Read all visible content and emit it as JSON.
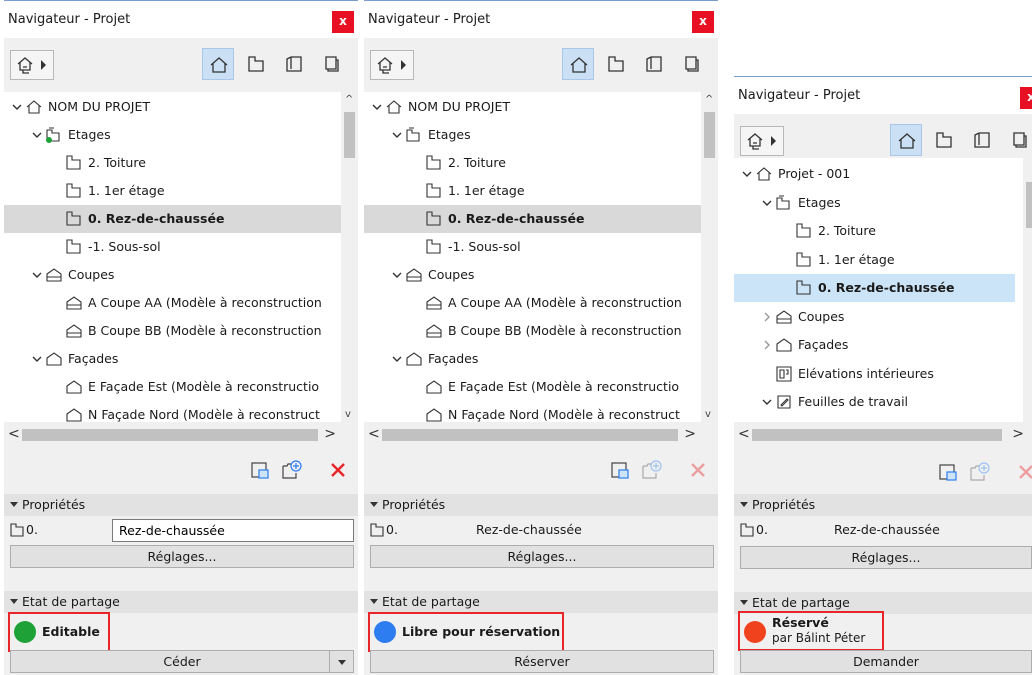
{
  "colors": {
    "accent": "#cce0f5",
    "close": "#e81123",
    "highlight": "#e8262a",
    "green": "#1ea238",
    "blue": "#2d7df0",
    "red": "#f0421c",
    "delete": "#e8262a"
  },
  "panels": [
    {
      "title": "Navigateur - Projet",
      "close": "x",
      "tree": [
        {
          "label": "NOM DU PROJET",
          "icon": "project-icon",
          "expander": "expanded"
        },
        {
          "label": "Etages",
          "icon": "stories-icon",
          "expander": "expanded"
        },
        {
          "label": "2. Toiture",
          "icon": "story-icon"
        },
        {
          "label": "1. 1er étage",
          "icon": "story-icon"
        },
        {
          "label": "0. Rez-de-chaussée",
          "icon": "story-icon"
        },
        {
          "label": "-1. Sous-sol",
          "icon": "story-icon"
        },
        {
          "label": "Coupes",
          "icon": "section-icon",
          "expander": "expanded"
        },
        {
          "label": "A Coupe AA (Modèle à reconstruction",
          "icon": "section-icon"
        },
        {
          "label": "B Coupe BB (Modèle à reconstruction",
          "icon": "section-icon"
        },
        {
          "label": "Façades",
          "icon": "elevation-icon",
          "expander": "expanded"
        },
        {
          "label": "E Façade Est (Modèle à reconstructio",
          "icon": "elevation-icon"
        },
        {
          "label": "N Façade Nord (Modèle à reconstruct",
          "icon": "elevation-icon"
        }
      ],
      "properties": {
        "header": "Propriétés",
        "number": "0.",
        "name": "Rez-de-chaussée",
        "settings": "Réglages..."
      },
      "sharing": {
        "header": "Etat de partage",
        "status": "Editable",
        "status_color": "green",
        "action": "Céder"
      }
    },
    {
      "title": "Navigateur - Projet",
      "close": "x",
      "tree": [
        {
          "label": "NOM DU PROJET",
          "icon": "project-icon",
          "expander": "expanded"
        },
        {
          "label": "Etages",
          "icon": "stories-icon",
          "expander": "expanded"
        },
        {
          "label": "2. Toiture",
          "icon": "story-icon"
        },
        {
          "label": "1. 1er étage",
          "icon": "story-icon"
        },
        {
          "label": "0. Rez-de-chaussée",
          "icon": "story-icon"
        },
        {
          "label": "-1. Sous-sol",
          "icon": "story-icon"
        },
        {
          "label": "Coupes",
          "icon": "section-icon",
          "expander": "expanded"
        },
        {
          "label": "A Coupe AA (Modèle à reconstruction",
          "icon": "section-icon"
        },
        {
          "label": "B Coupe BB (Modèle à reconstruction",
          "icon": "section-icon"
        },
        {
          "label": "Façades",
          "icon": "elevation-icon",
          "expander": "expanded"
        },
        {
          "label": "E Façade Est (Modèle à reconstructio",
          "icon": "elevation-icon"
        },
        {
          "label": "N Façade Nord (Modèle à reconstruct",
          "icon": "elevation-icon"
        }
      ],
      "properties": {
        "header": "Propriétés",
        "number": "0.",
        "name": "Rez-de-chaussée",
        "settings": "Réglages..."
      },
      "sharing": {
        "header": "Etat de partage",
        "status": "Libre pour réservation",
        "status_color": "blue",
        "action": "Réserver"
      }
    },
    {
      "title": "Navigateur - Projet",
      "close": "x",
      "tree": [
        {
          "label": "Projet - 001",
          "icon": "project-icon",
          "expander": "expanded"
        },
        {
          "label": "Etages",
          "icon": "stories-icon",
          "expander": "expanded"
        },
        {
          "label": "2. Toiture",
          "icon": "story-icon"
        },
        {
          "label": "1. 1er étage",
          "icon": "story-icon"
        },
        {
          "label": "0. Rez-de-chaussée",
          "icon": "story-icon"
        },
        {
          "label": "Coupes",
          "icon": "section-icon",
          "expander": "collapsed"
        },
        {
          "label": "Façades",
          "icon": "elevation-icon",
          "expander": "collapsed"
        },
        {
          "label": "Elévations intérieures",
          "icon": "interior-elevation-icon"
        },
        {
          "label": "Feuilles de travail",
          "icon": "worksheet-icon",
          "expander": "expanded"
        }
      ],
      "properties": {
        "header": "Propriétés",
        "number": "0.",
        "name": "Rez-de-chaussée",
        "settings": "Réglages..."
      },
      "sharing": {
        "header": "Etat de partage",
        "status": "Réservé",
        "status_by": "par Bálint Péter",
        "status_color": "red",
        "action": "Demander"
      }
    }
  ]
}
